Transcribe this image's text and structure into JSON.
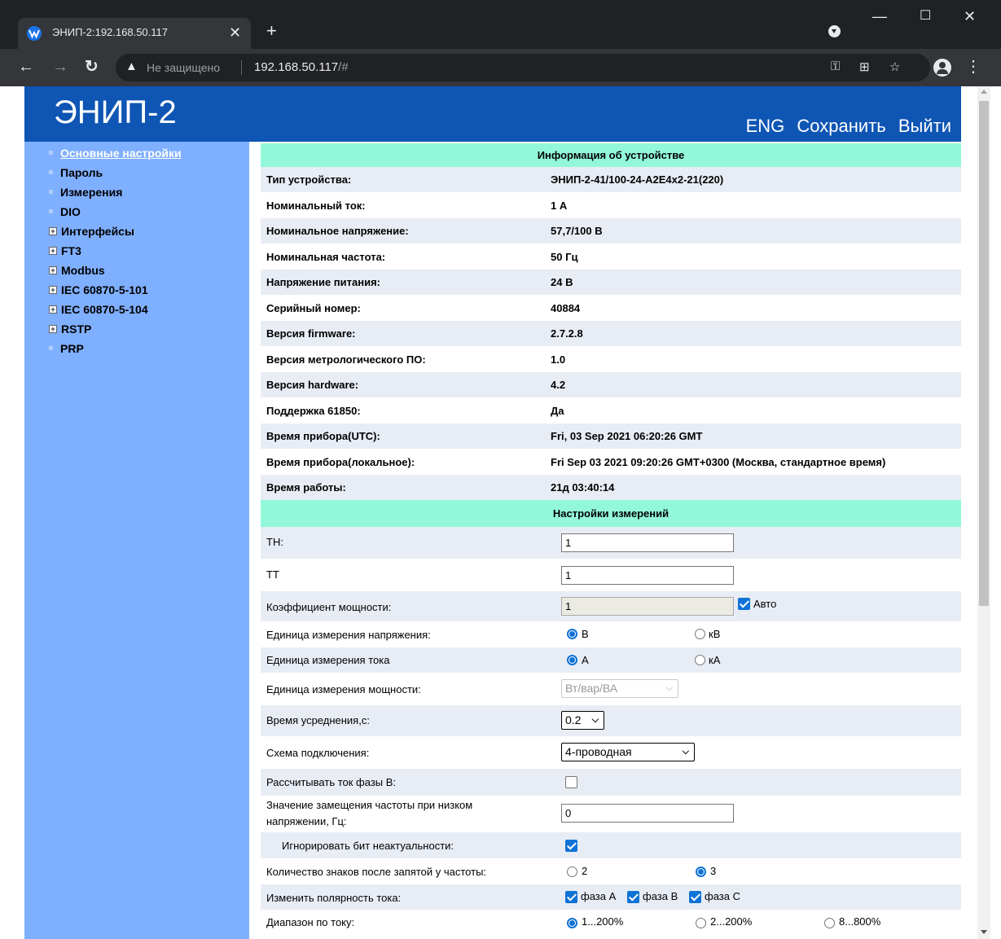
{
  "browser": {
    "tab_title": "ЭНИП-2:192.168.50.117",
    "security_label": "Не защищено",
    "url_host": "192.168.50.117",
    "url_path": "/#"
  },
  "header": {
    "logo": "ЭНИП-2",
    "lang": "ENG",
    "save": "Сохранить",
    "logout": "Выйти"
  },
  "sidebar": {
    "items": [
      {
        "label": "Основные настройки"
      },
      {
        "label": "Пароль"
      },
      {
        "label": "Измерения"
      },
      {
        "label": "DIO"
      },
      {
        "label": "Интерфейсы"
      },
      {
        "label": "FT3"
      },
      {
        "label": "Modbus"
      },
      {
        "label": "IEC 60870-5-101"
      },
      {
        "label": "IEC 60870-5-104"
      },
      {
        "label": "RSTP"
      },
      {
        "label": "PRP"
      }
    ]
  },
  "info": {
    "title": "Информация об устройстве",
    "rows": [
      {
        "label": "Тип устройства:",
        "value": "ЭНИП-2-41/100-24-А2Е4х2-21(220)"
      },
      {
        "label": "Номинальный ток:",
        "value": "1 А"
      },
      {
        "label": "Номинальное напряжение:",
        "value": "57,7/100 В"
      },
      {
        "label": "Номинальная частота:",
        "value": "50 Гц"
      },
      {
        "label": "Напряжение питания:",
        "value": "24 В"
      },
      {
        "label": "Серийный номер:",
        "value": "40884"
      },
      {
        "label": "Версия firmware:",
        "value": "2.7.2.8"
      },
      {
        "label": "Версия метрологического ПО:",
        "value": "1.0"
      },
      {
        "label": "Версия hardware:",
        "value": "4.2"
      },
      {
        "label": "Поддержка 61850:",
        "value": "Да"
      },
      {
        "label": "Время прибора(UTC):",
        "value": "Fri, 03 Sep 2021 06:20:26 GMT"
      },
      {
        "label": "Время прибора(локальное):",
        "value": "Fri Sep 03 2021 09:20:26 GMT+0300 (Москва, стандартное время)"
      },
      {
        "label": "Время работы:",
        "value": "21д 03:40:14"
      }
    ]
  },
  "measure": {
    "title": "Настройки измерений",
    "th_label": "ТН:",
    "th_value": "1",
    "tt_label": "ТТ",
    "tt_value": "1",
    "pf_label": "Коэффициент мощности:",
    "pf_value": "1",
    "pf_auto": "Авто",
    "volt_unit_label": "Единица измерения напряжения:",
    "volt_unit_opt1": "В",
    "volt_unit_opt2": "кВ",
    "cur_unit_label": "Единица измерения тока",
    "cur_unit_opt1": "А",
    "cur_unit_opt2": "кА",
    "pow_unit_label": "Единица измерения мощности:",
    "pow_unit_value": "Вт/вар/ВА",
    "avg_label": "Время усреднения,с:",
    "avg_value": "0.2",
    "scheme_label": "Схема подключения:",
    "scheme_value": "4-проводная",
    "calc_b_label": "Рассчитывать ток фазы В:",
    "freq_sub_label_1": "Значение замещения частоты при низком",
    "freq_sub_label_2": "напряжении, Гц:",
    "freq_sub_value": "0",
    "ignore_label": "Игнорировать бит неактуальности:",
    "decimals_label": "Количество знаков после запятой у частоты:",
    "decimals_opt1": "2",
    "decimals_opt2": "3",
    "polarity_label": "Изменить полярность тока:",
    "polarity_a": "фаза А",
    "polarity_b": "фаза В",
    "polarity_c": "фаза С",
    "range_label": "Диапазон по току:",
    "range_opt1": "1...200%",
    "range_opt2": "2...200%",
    "range_opt3": "8...800%"
  },
  "colors": {
    "header_bg": "#0e55b4",
    "sidebar_bg": "#7fafff",
    "section_bg": "#93f8d9",
    "row_alt_bg": "#e8edf5",
    "accent": "#0f72d6"
  }
}
